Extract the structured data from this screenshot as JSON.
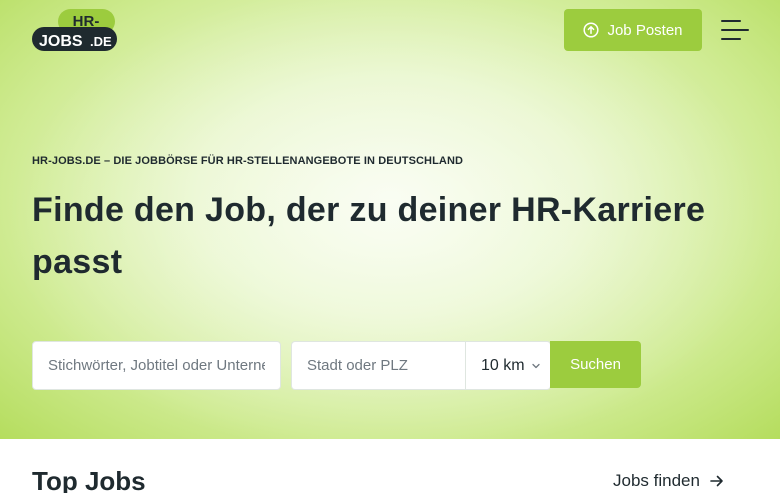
{
  "header": {
    "logo": {
      "top_text": "HR-",
      "bottom_text": "JOBS",
      "suffix": ".DE"
    },
    "post_job_label": "Job Posten",
    "post_job_icon": "arrow-up-circle-icon",
    "menu_icon": "menu-icon"
  },
  "hero": {
    "kicker": "HR-JOBS.DE – DIE JOBBÖRSE FÜR HR-STELLENANGEBOTE IN DEUTSCHLAND",
    "headline": "Finde den Job, der zu deiner HR-Karriere passt"
  },
  "search": {
    "keyword_placeholder": "Stichwörter, Jobtitel oder Unternehmen",
    "location_placeholder": "Stadt oder PLZ",
    "radius_value": "10 km",
    "submit_label": "Suchen"
  },
  "top_jobs": {
    "title": "Top Jobs",
    "link_label": "Jobs finden"
  },
  "colors": {
    "accent": "#9ccc3e",
    "text": "#1f2a2f"
  }
}
